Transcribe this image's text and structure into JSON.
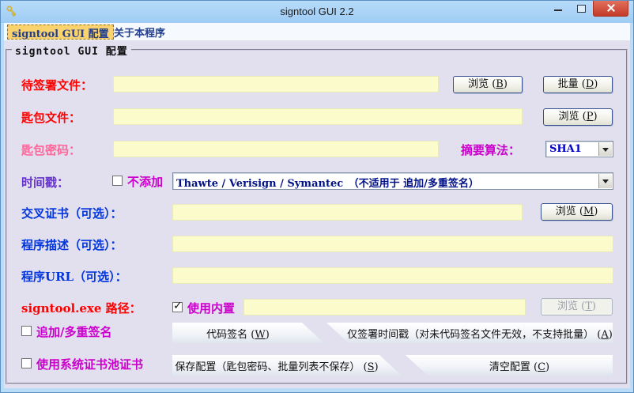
{
  "window": {
    "title": "signtool GUI 2.2"
  },
  "icons": {
    "app": "key-icon",
    "minimize": "minimize-icon",
    "maximize": "maximize-icon",
    "close": "close-icon",
    "combo_arrow": "chevron-down-icon"
  },
  "menubar": {
    "items": [
      {
        "label": "signtool GUI 配置",
        "highlighted": true
      },
      {
        "label": "关于本程序",
        "highlighted": false
      }
    ]
  },
  "group": {
    "title": "signtool GUI 配置"
  },
  "form": {
    "target": {
      "label": "待签署文件：",
      "value": ""
    },
    "keybag": {
      "label": "匙包文件：",
      "value": ""
    },
    "password": {
      "label": "匙包密码：",
      "value": ""
    },
    "digest": {
      "label": "摘要算法：",
      "selected": "SHA1"
    },
    "timestamp": {
      "label": "时间戳：",
      "no_add_label": "不添加",
      "no_add_checked": false,
      "selected": "Thawte / Verisign / Symantec　（不适用于 追加/多重签名）"
    },
    "cross_cert": {
      "label": "交叉证书（可选）：",
      "value": ""
    },
    "description": {
      "label": "程序描述（可选）：",
      "value": ""
    },
    "url": {
      "label": "程序URL（可选）：",
      "value": ""
    },
    "signtool_path": {
      "label": "signtool.exe 路径：",
      "builtin_label": "使用内置",
      "builtin_checked": true,
      "value": ""
    },
    "append_sign": {
      "label": "追加/多重签名",
      "checked": false
    },
    "system_store": {
      "label": "使用系统证书池证书",
      "checked": false
    }
  },
  "buttons": {
    "browse_b": {
      "text": "浏览 (",
      "mnemonic": "B",
      "suffix": ")"
    },
    "batch_d": {
      "text": "批量 (",
      "mnemonic": "D",
      "suffix": ")"
    },
    "browse_p": {
      "text": "浏览 (",
      "mnemonic": "P",
      "suffix": ")"
    },
    "browse_m": {
      "text": "浏览 (",
      "mnemonic": "M",
      "suffix": ")"
    },
    "browse_t": {
      "text": "浏览 (",
      "mnemonic": "T",
      "suffix": ")",
      "disabled": true
    },
    "code_sign": {
      "text": "代码签名 (",
      "mnemonic": "W",
      "suffix": ")"
    },
    "timestamp_only": {
      "text": "仅签署时间戳（对未代码签名文件无效，不支持批量） (",
      "mnemonic": "A",
      "suffix": ")"
    },
    "save_config": {
      "text": "保存配置（匙包密码、批量列表不保存） (",
      "mnemonic": "S",
      "suffix": ")"
    },
    "clear_config": {
      "text": "清空配置 (",
      "mnemonic": "C",
      "suffix": ")"
    }
  },
  "glyphs": {
    "check": "✓"
  },
  "colors": {
    "titlebar": "#A8D2F6",
    "frame": "#B9DCF8",
    "client_bg": "#E2DFEF",
    "input_bg": "#FBFBCB",
    "menu_highlight": "#FBD36E",
    "close_red": "#C23A28",
    "label_red": "#FF0000",
    "label_pink": "#FF6699",
    "label_magenta": "#CC00CC",
    "label_violet": "#6633CC",
    "label_blue": "#0336DD",
    "combo_text": "#001286"
  }
}
